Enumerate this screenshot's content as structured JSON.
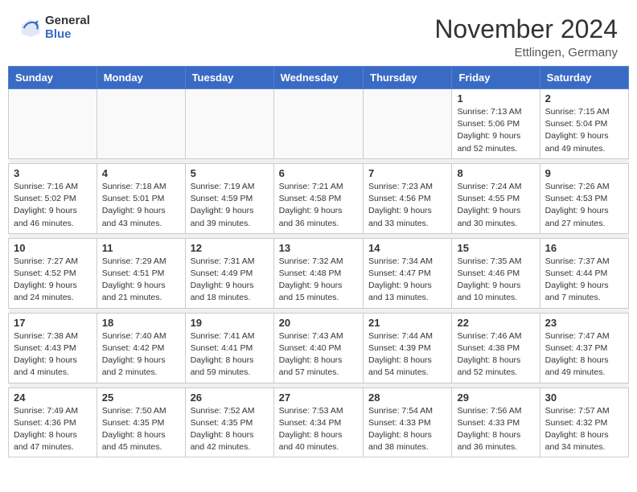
{
  "header": {
    "logo_general": "General",
    "logo_blue": "Blue",
    "month_title": "November 2024",
    "location": "Ettlingen, Germany"
  },
  "days_of_week": [
    "Sunday",
    "Monday",
    "Tuesday",
    "Wednesday",
    "Thursday",
    "Friday",
    "Saturday"
  ],
  "weeks": [
    [
      {
        "day": "",
        "info": ""
      },
      {
        "day": "",
        "info": ""
      },
      {
        "day": "",
        "info": ""
      },
      {
        "day": "",
        "info": ""
      },
      {
        "day": "",
        "info": ""
      },
      {
        "day": "1",
        "info": "Sunrise: 7:13 AM\nSunset: 5:06 PM\nDaylight: 9 hours\nand 52 minutes."
      },
      {
        "day": "2",
        "info": "Sunrise: 7:15 AM\nSunset: 5:04 PM\nDaylight: 9 hours\nand 49 minutes."
      }
    ],
    [
      {
        "day": "3",
        "info": "Sunrise: 7:16 AM\nSunset: 5:02 PM\nDaylight: 9 hours\nand 46 minutes."
      },
      {
        "day": "4",
        "info": "Sunrise: 7:18 AM\nSunset: 5:01 PM\nDaylight: 9 hours\nand 43 minutes."
      },
      {
        "day": "5",
        "info": "Sunrise: 7:19 AM\nSunset: 4:59 PM\nDaylight: 9 hours\nand 39 minutes."
      },
      {
        "day": "6",
        "info": "Sunrise: 7:21 AM\nSunset: 4:58 PM\nDaylight: 9 hours\nand 36 minutes."
      },
      {
        "day": "7",
        "info": "Sunrise: 7:23 AM\nSunset: 4:56 PM\nDaylight: 9 hours\nand 33 minutes."
      },
      {
        "day": "8",
        "info": "Sunrise: 7:24 AM\nSunset: 4:55 PM\nDaylight: 9 hours\nand 30 minutes."
      },
      {
        "day": "9",
        "info": "Sunrise: 7:26 AM\nSunset: 4:53 PM\nDaylight: 9 hours\nand 27 minutes."
      }
    ],
    [
      {
        "day": "10",
        "info": "Sunrise: 7:27 AM\nSunset: 4:52 PM\nDaylight: 9 hours\nand 24 minutes."
      },
      {
        "day": "11",
        "info": "Sunrise: 7:29 AM\nSunset: 4:51 PM\nDaylight: 9 hours\nand 21 minutes."
      },
      {
        "day": "12",
        "info": "Sunrise: 7:31 AM\nSunset: 4:49 PM\nDaylight: 9 hours\nand 18 minutes."
      },
      {
        "day": "13",
        "info": "Sunrise: 7:32 AM\nSunset: 4:48 PM\nDaylight: 9 hours\nand 15 minutes."
      },
      {
        "day": "14",
        "info": "Sunrise: 7:34 AM\nSunset: 4:47 PM\nDaylight: 9 hours\nand 13 minutes."
      },
      {
        "day": "15",
        "info": "Sunrise: 7:35 AM\nSunset: 4:46 PM\nDaylight: 9 hours\nand 10 minutes."
      },
      {
        "day": "16",
        "info": "Sunrise: 7:37 AM\nSunset: 4:44 PM\nDaylight: 9 hours\nand 7 minutes."
      }
    ],
    [
      {
        "day": "17",
        "info": "Sunrise: 7:38 AM\nSunset: 4:43 PM\nDaylight: 9 hours\nand 4 minutes."
      },
      {
        "day": "18",
        "info": "Sunrise: 7:40 AM\nSunset: 4:42 PM\nDaylight: 9 hours\nand 2 minutes."
      },
      {
        "day": "19",
        "info": "Sunrise: 7:41 AM\nSunset: 4:41 PM\nDaylight: 8 hours\nand 59 minutes."
      },
      {
        "day": "20",
        "info": "Sunrise: 7:43 AM\nSunset: 4:40 PM\nDaylight: 8 hours\nand 57 minutes."
      },
      {
        "day": "21",
        "info": "Sunrise: 7:44 AM\nSunset: 4:39 PM\nDaylight: 8 hours\nand 54 minutes."
      },
      {
        "day": "22",
        "info": "Sunrise: 7:46 AM\nSunset: 4:38 PM\nDaylight: 8 hours\nand 52 minutes."
      },
      {
        "day": "23",
        "info": "Sunrise: 7:47 AM\nSunset: 4:37 PM\nDaylight: 8 hours\nand 49 minutes."
      }
    ],
    [
      {
        "day": "24",
        "info": "Sunrise: 7:49 AM\nSunset: 4:36 PM\nDaylight: 8 hours\nand 47 minutes."
      },
      {
        "day": "25",
        "info": "Sunrise: 7:50 AM\nSunset: 4:35 PM\nDaylight: 8 hours\nand 45 minutes."
      },
      {
        "day": "26",
        "info": "Sunrise: 7:52 AM\nSunset: 4:35 PM\nDaylight: 8 hours\nand 42 minutes."
      },
      {
        "day": "27",
        "info": "Sunrise: 7:53 AM\nSunset: 4:34 PM\nDaylight: 8 hours\nand 40 minutes."
      },
      {
        "day": "28",
        "info": "Sunrise: 7:54 AM\nSunset: 4:33 PM\nDaylight: 8 hours\nand 38 minutes."
      },
      {
        "day": "29",
        "info": "Sunrise: 7:56 AM\nSunset: 4:33 PM\nDaylight: 8 hours\nand 36 minutes."
      },
      {
        "day": "30",
        "info": "Sunrise: 7:57 AM\nSunset: 4:32 PM\nDaylight: 8 hours\nand 34 minutes."
      }
    ]
  ]
}
